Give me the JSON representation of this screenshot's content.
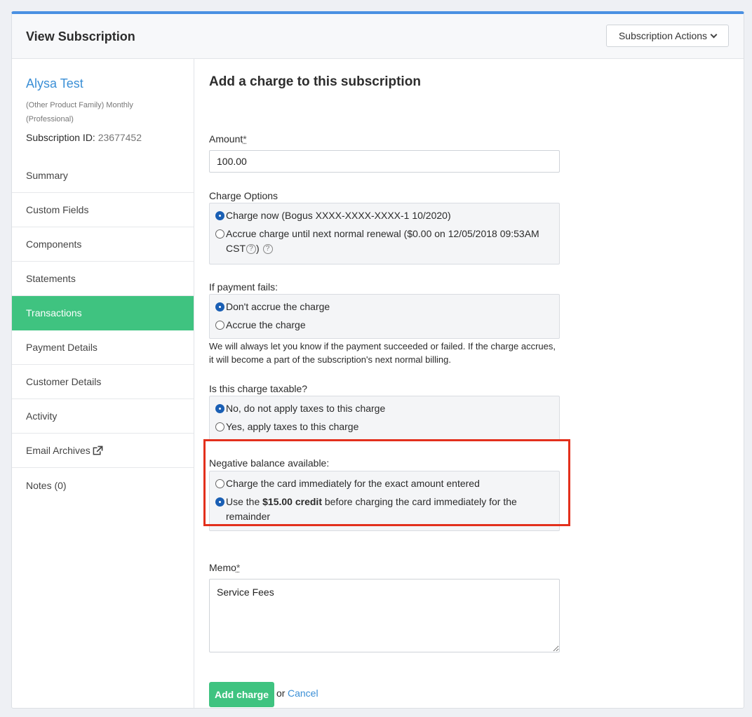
{
  "header": {
    "title": "View Subscription",
    "actions_label": "Subscription Actions"
  },
  "sidebar": {
    "customer_name": "Alysa Test",
    "plan": "(Other Product Family) Monthly (Professional)",
    "subscription_id_label": "Subscription ID:",
    "subscription_id": "23677452",
    "items": [
      {
        "label": "Summary"
      },
      {
        "label": "Custom Fields"
      },
      {
        "label": "Components"
      },
      {
        "label": "Statements"
      },
      {
        "label": "Transactions",
        "active": true
      },
      {
        "label": "Payment Details"
      },
      {
        "label": "Customer Details"
      },
      {
        "label": "Activity"
      },
      {
        "label": "Email Archives",
        "icon": "external-link-icon"
      },
      {
        "label": "Notes (0)"
      }
    ]
  },
  "form": {
    "title": "Add a charge to this subscription",
    "amount": {
      "label": "Amount",
      "required_mark": "*",
      "value": "100.00"
    },
    "charge_options": {
      "label": "Charge Options",
      "opt1": "Charge now (Bogus XXXX-XXXX-XXXX-1 10/2020)",
      "opt2": "Accrue charge until next normal renewal ($0.00 on 12/05/2018 09:53AM CST",
      "opt2_close": ")",
      "help_glyph": "?"
    },
    "payment_fails": {
      "label": "If payment fails:",
      "opt1": "Don't accrue the charge",
      "opt2": "Accrue the charge",
      "help": "We will always let you know if the payment succeeded or failed. If the charge accrues, it will become a part of the subscription's next normal billing."
    },
    "taxable": {
      "label": "Is this charge taxable?",
      "opt1": "No, do not apply taxes to this charge",
      "opt2": "Yes, apply taxes to this charge"
    },
    "negative_balance": {
      "label": "Negative balance available:",
      "opt1": "Charge the card immediately for the exact amount entered",
      "opt2_prefix": "Use the ",
      "opt2_bold": "$15.00 credit",
      "opt2_suffix": " before charging the card immediately for the remainder"
    },
    "memo": {
      "label": "Memo",
      "required_mark": "*",
      "value": "Service Fees"
    },
    "submit_label": "Add charge",
    "or_text": "or",
    "cancel_label": "Cancel"
  },
  "colors": {
    "accent_green": "#3fc380",
    "link_blue": "#3b8fd6",
    "highlight_red": "#e3301c",
    "radio_blue": "#1a5fb4"
  }
}
